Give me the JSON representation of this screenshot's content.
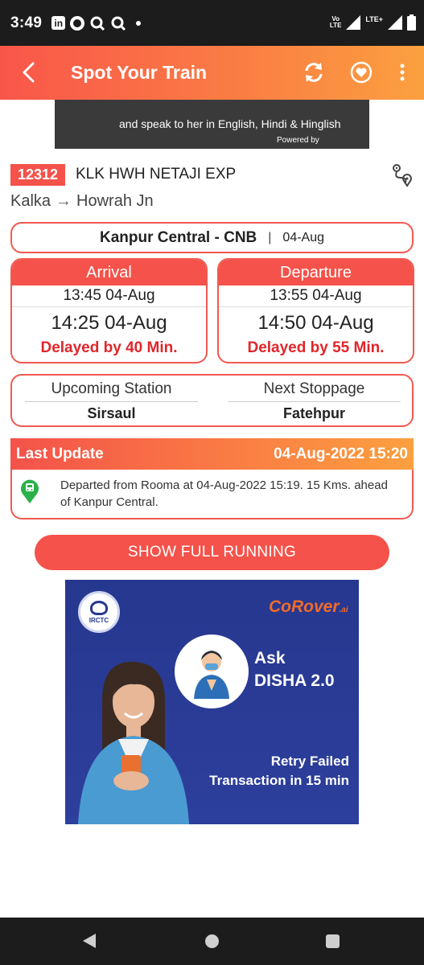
{
  "status_bar": {
    "time": "3:49",
    "linkedin_glyph": "in",
    "volte_top": "Vo",
    "volte_bottom": "LTE",
    "lte_plus": "LTE+"
  },
  "app_bar": {
    "title": "Spot Your Train",
    "icons": [
      "back-arrow-icon",
      "refresh-icon",
      "heart-icon",
      "more-vert-icon"
    ]
  },
  "top_ad": {
    "line1": "and speak to her in English, Hindi & Hinglish",
    "line2": "Powered by"
  },
  "train": {
    "number": "12312",
    "name": "KLK HWH NETAJI EXP",
    "from": "Kalka",
    "arrow": "→",
    "to": "Howrah Jn"
  },
  "station": {
    "name": "Kanpur Central - CNB",
    "separator": "|",
    "date": "04-Aug"
  },
  "arrival": {
    "label": "Arrival",
    "scheduled": "13:45 04-Aug",
    "actual": "14:25 04-Aug",
    "delay": "Delayed by 40 Min."
  },
  "departure": {
    "label": "Departure",
    "scheduled": "13:55 04-Aug",
    "actual": "14:50 04-Aug",
    "delay": "Delayed by 55 Min."
  },
  "upcoming": {
    "upcoming_label": "Upcoming Station",
    "upcoming_value": "Sirsaul",
    "next_label": "Next Stoppage",
    "next_value": "Fatehpur"
  },
  "last_update": {
    "label": "Last Update",
    "timestamp": "04-Aug-2022 15:20",
    "message": "Departed from Rooma at 04-Aug-2022 15:19. 15 Kms. ahead of Kanpur Central."
  },
  "show_full_button": "SHOW FULL RUNNING",
  "big_ad": {
    "irctc": "IRCTC",
    "brand": "CoRover",
    "brand_suffix": ".ai",
    "ask_line1": "Ask",
    "ask_line2": "DISHA 2.0",
    "retry_line1": "Retry Failed",
    "retry_line2": "Transaction in 15 min"
  },
  "colors": {
    "accent": "#f4524a",
    "gradient_end": "#fba03f",
    "delay_red": "#e0262a",
    "ad_blue": "#26378f"
  }
}
